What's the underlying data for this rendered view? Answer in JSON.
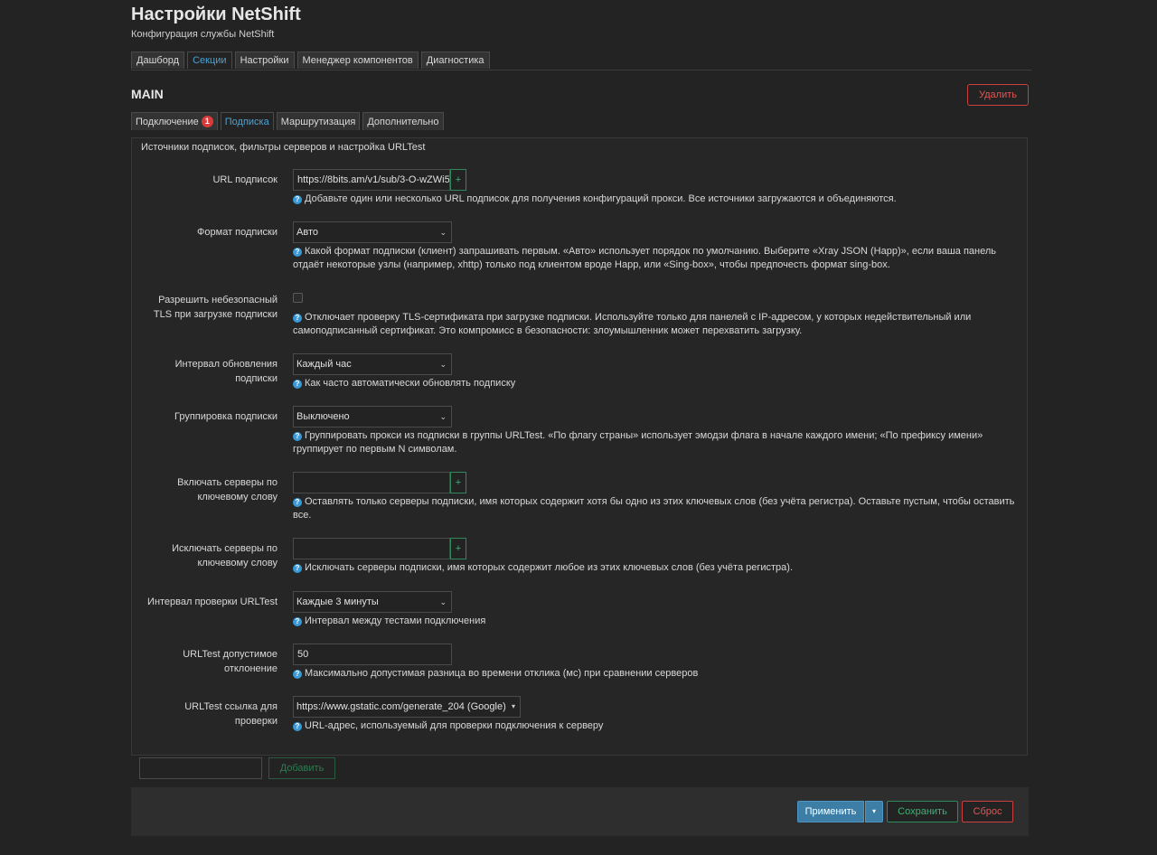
{
  "page": {
    "title": "Настройки NetShift",
    "subtitle": "Конфигурация службы NetShift"
  },
  "tabs": [
    "Дашборд",
    "Секции",
    "Настройки",
    "Менеджер компонентов",
    "Диагностика"
  ],
  "active_tab": "Секции",
  "section": {
    "name": "MAIN",
    "delete_label": "Удалить"
  },
  "subtabs": [
    {
      "label": "Подключение",
      "badge": "1"
    },
    {
      "label": "Подписка"
    },
    {
      "label": "Маршрутизация"
    },
    {
      "label": "Дополнительно"
    }
  ],
  "active_subtab": "Подписка",
  "panel_description": "Источники подписок, фильтры серверов и настройка URLTest",
  "fields": {
    "url": {
      "label": "URL подписок",
      "value": "https://8bits.am/v1/sub/3-O-wZWi5",
      "help": "Добавьте один или несколько URL подписок для получения конфигураций прокси. Все источники загружаются и объединяются."
    },
    "format": {
      "label": "Формат подписки",
      "value": "Авто",
      "help": "Какой формат подписки (клиент) запрашивать первым. «Авто» использует порядок по умолчанию. Выберите «Xray JSON (Happ)», если ваша панель отдаёт некоторые узлы (например, xhttp) только под клиентом вроде Happ, или «Sing-box», чтобы предпочесть формат sing-box."
    },
    "insecure": {
      "label": "Разрешить небезопасный TLS при загрузке подписки",
      "checked": false,
      "help": "Отключает проверку TLS-сертификата при загрузке подписки. Используйте только для панелей с IP-адресом, у которых недействительный или самоподписанный сертификат. Это компромисс в безопасности: злоумышленник может перехватить загрузку."
    },
    "interval": {
      "label": "Интервал обновления подписки",
      "value": "Каждый час",
      "help": "Как часто автоматически обновлять подписку"
    },
    "grouping": {
      "label": "Группировка подписки",
      "value": "Выключено",
      "help": "Группировать прокси из подписки в группы URLTest. «По флагу страны» использует эмодзи флага в начале каждого имени; «По префиксу имени» группирует по первым N символам."
    },
    "include": {
      "label": "Включать серверы по ключевому слову",
      "value": "",
      "help": "Оставлять только серверы подписки, имя которых содержит хотя бы одно из этих ключевых слов (без учёта регистра). Оставьте пустым, чтобы оставить все."
    },
    "exclude": {
      "label": "Исключать серверы по ключевому слову",
      "value": "",
      "help": "Исключать серверы подписки, имя которых содержит любое из этих ключевых слов (без учёта регистра)."
    },
    "urltest_interval": {
      "label": "Интервал проверки URLTest",
      "value": "Каждые 3 минуты",
      "help": "Интервал между тестами подключения"
    },
    "tolerance": {
      "label": "URLTest допустимое отклонение",
      "value": "50",
      "help": "Максимально допустимая разница во времени отклика (мс) при сравнении серверов"
    },
    "check_url": {
      "label": "URLTest ссылка для проверки",
      "value": "https://www.gstatic.com/generate_204 (Google)",
      "help": "URL-адрес, используемый для проверки подключения к серверу"
    }
  },
  "add_button_label": "Добавить",
  "footer": {
    "apply": "Применить",
    "save": "Сохранить",
    "reset": "Сброс"
  },
  "icons": {
    "plus": "+",
    "chevron": "⌄",
    "help": "?"
  },
  "colors": {
    "accent_blue": "#4aa3d4",
    "danger": "#e25555",
    "success": "#3ab374",
    "apply_bg": "#3d7ea6"
  }
}
